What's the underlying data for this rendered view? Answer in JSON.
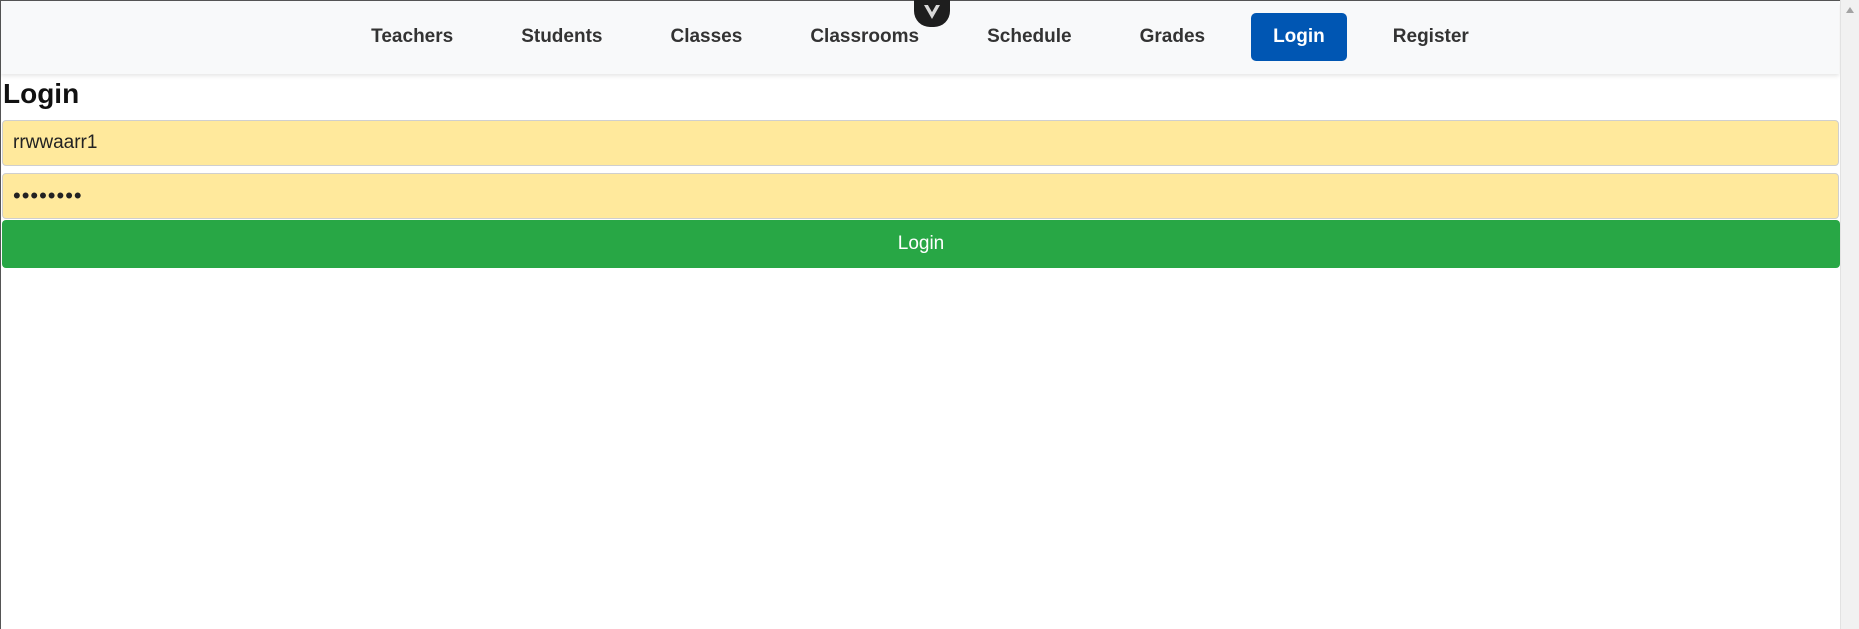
{
  "nav": {
    "items": [
      {
        "label": "Teachers",
        "active": false
      },
      {
        "label": "Students",
        "active": false
      },
      {
        "label": "Classes",
        "active": false
      },
      {
        "label": "Classrooms",
        "active": false
      },
      {
        "label": "Schedule",
        "active": false
      },
      {
        "label": "Grades",
        "active": false
      },
      {
        "label": "Login",
        "active": true
      },
      {
        "label": "Register",
        "active": false
      }
    ]
  },
  "page": {
    "title": "Login"
  },
  "form": {
    "username_value": "rrwwaarr1",
    "password_value": "••••••••",
    "submit_label": "Login"
  },
  "colors": {
    "nav_active_bg": "#0056b3",
    "input_bg": "#ffe99c",
    "submit_bg": "#28a745"
  },
  "icons": {
    "devtools_toggle": "vue-devtools-icon"
  }
}
